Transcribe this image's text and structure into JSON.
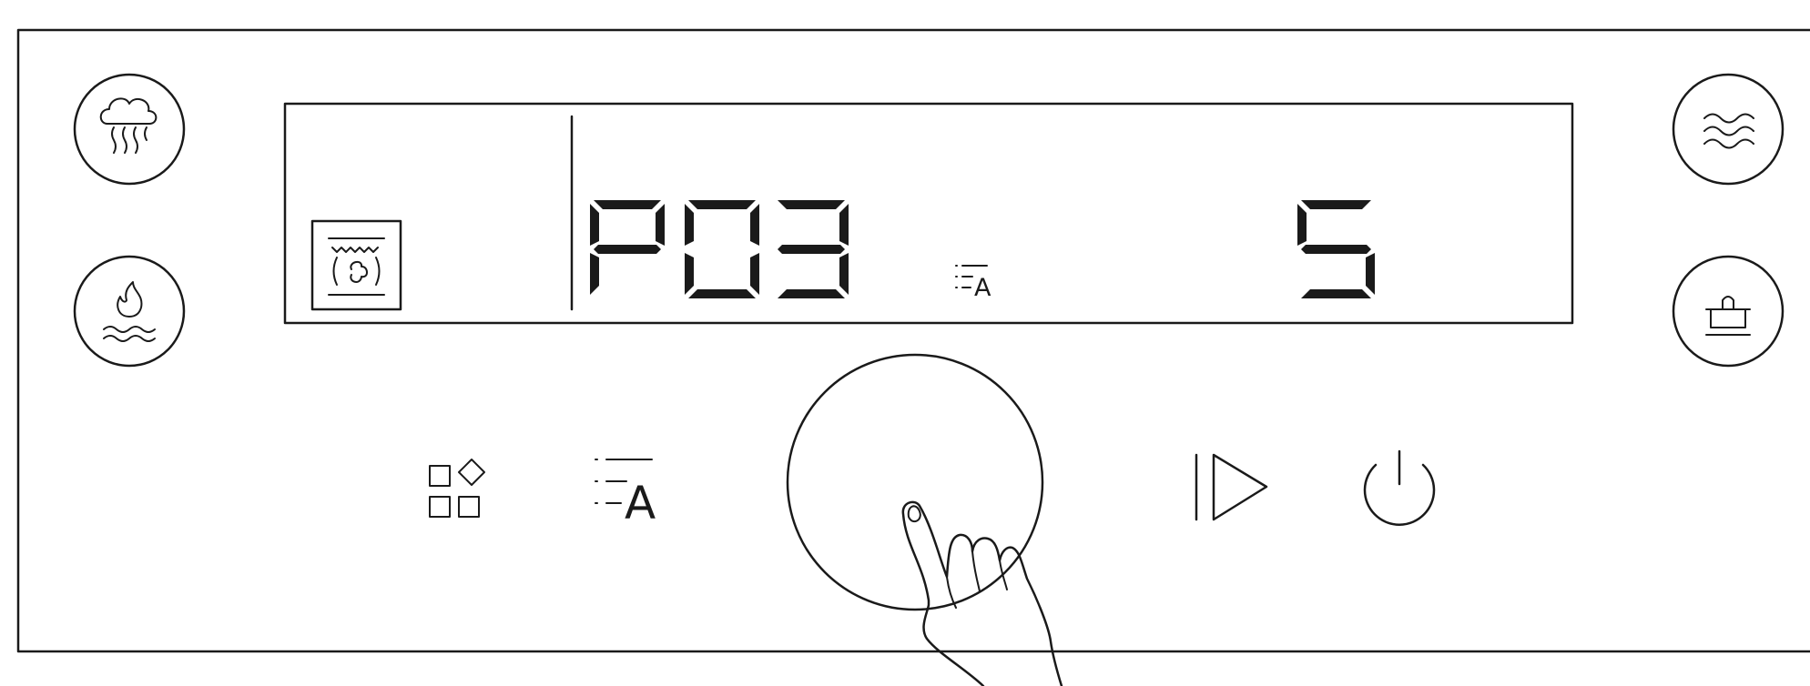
{
  "display": {
    "program_code": "P03",
    "program_segments": {
      "P": [
        "a",
        "b",
        "e",
        "f",
        "g"
      ],
      "0": [
        "a",
        "b",
        "c",
        "d",
        "e",
        "f"
      ],
      "3": [
        "a",
        "b",
        "c",
        "d",
        "g"
      ]
    },
    "level_value": "5",
    "level_segments": [
      "a",
      "c",
      "d",
      "f",
      "g"
    ],
    "auto_letter": "A"
  },
  "controls": {
    "auto_letter": "A"
  },
  "icons": {
    "top_left": "steam-icon",
    "bottom_left": "flame-water-icon",
    "top_right": "microwave-waves-icon",
    "bottom_right": "pot-icon",
    "display_mode": "fan-oven-icon",
    "programs": "programs-grid-icon",
    "auto_program": "auto-menu-icon",
    "start": "start-play-icon",
    "power": "power-icon",
    "gesture": "finger-tap-icon"
  },
  "colors": {
    "line": "#1a1a1a",
    "background": "#ffffff"
  }
}
